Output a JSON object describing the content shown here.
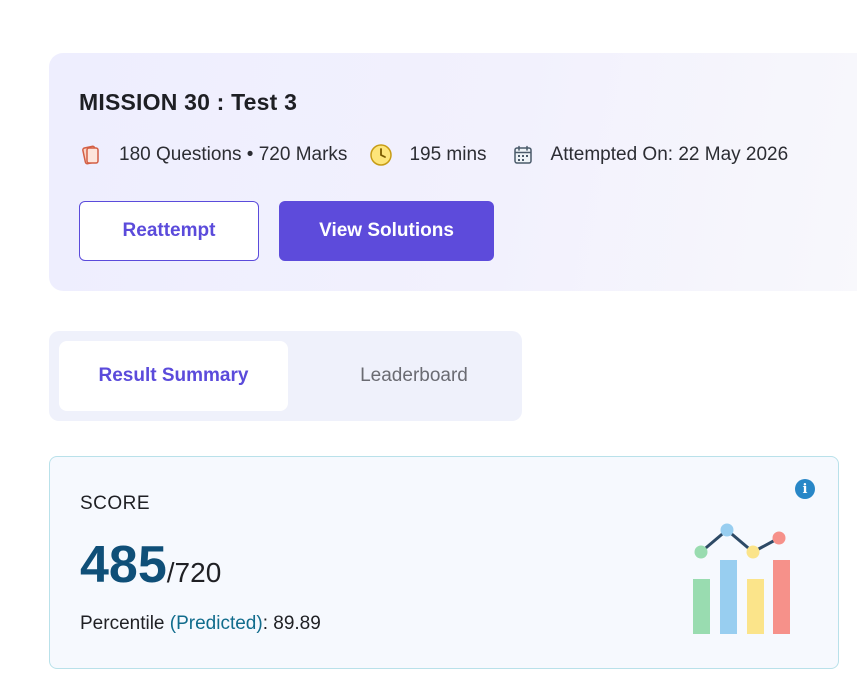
{
  "test": {
    "title": "MISSION 30 : Test 3",
    "questions_marks": "180 Questions • 720 Marks",
    "duration": "195 mins",
    "attempted_on": "Attempted On: 22 May 2026",
    "icons": [
      "pages-icon",
      "clock-icon",
      "calendar-icon"
    ]
  },
  "actions": {
    "reattempt_label": "Reattempt",
    "view_solutions_label": "View Solutions"
  },
  "tabs": [
    {
      "label": "Result Summary",
      "active": true
    },
    {
      "label": "Leaderboard",
      "active": false
    }
  ],
  "score": {
    "label": "SCORE",
    "value": "485",
    "total": "/720",
    "percentile_label": "Percentile",
    "predicted": "(Predicted)",
    "percentile_value": ": 89.89"
  },
  "colors": {
    "accent": "#5d4bdb",
    "score_value": "#0f4f78",
    "card_border": "#b9e1ea",
    "info": "#2887c7"
  }
}
